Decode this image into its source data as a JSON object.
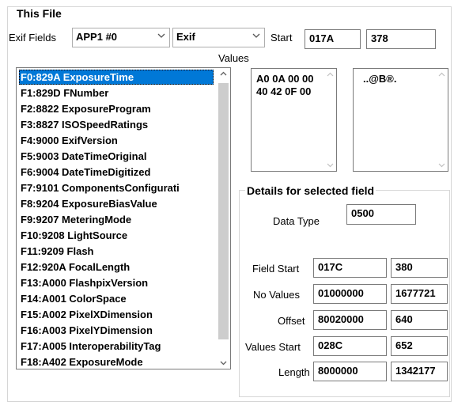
{
  "group": {
    "title": "This File"
  },
  "exif_fields": {
    "label": "Exif Fields",
    "segment": "APP1 #0",
    "ifd": "Exif"
  },
  "start": {
    "label": "Start",
    "hex": "017A",
    "dec": "378"
  },
  "values": {
    "label": "Values",
    "hex_lines": [
      "A0 0A 00 00",
      "40 42 0F 00"
    ],
    "ascii": "..@B®."
  },
  "fields": {
    "selected_index": 0,
    "items": [
      "F0:829A ExposureTime",
      "F1:829D FNumber",
      "F2:8822 ExposureProgram",
      "F3:8827 ISOSpeedRatings",
      "F4:9000 ExifVersion",
      "F5:9003 DateTimeOriginal",
      "F6:9004 DateTimeDigitized",
      "F7:9101 ComponentsConfigurati",
      "F8:9204 ExposureBiasValue",
      "F9:9207 MeteringMode",
      "F10:9208 LightSource",
      "F11:9209 Flash",
      "F12:920A FocalLength",
      "F13:A000 FlashpixVersion",
      "F14:A001 ColorSpace",
      "F15:A002 PixelXDimension",
      "F16:A003 PixelYDimension",
      "F17:A005 InteroperabilityTag",
      "F18:A402 ExposureMode"
    ]
  },
  "details": {
    "title": "Details for selected field",
    "data_type_label": "Data Type",
    "data_type": "0500",
    "rows": [
      {
        "label": "Field Start",
        "hex": "017C",
        "dec": "380"
      },
      {
        "label": "No Values",
        "hex": "01000000",
        "dec": "1677721"
      },
      {
        "label": "Offset",
        "hex": "80020000",
        "dec": "640"
      },
      {
        "label": "Values Start",
        "hex": "028C",
        "dec": "652"
      },
      {
        "label": "Length",
        "hex": "8000000",
        "dec": "1342177"
      }
    ]
  }
}
